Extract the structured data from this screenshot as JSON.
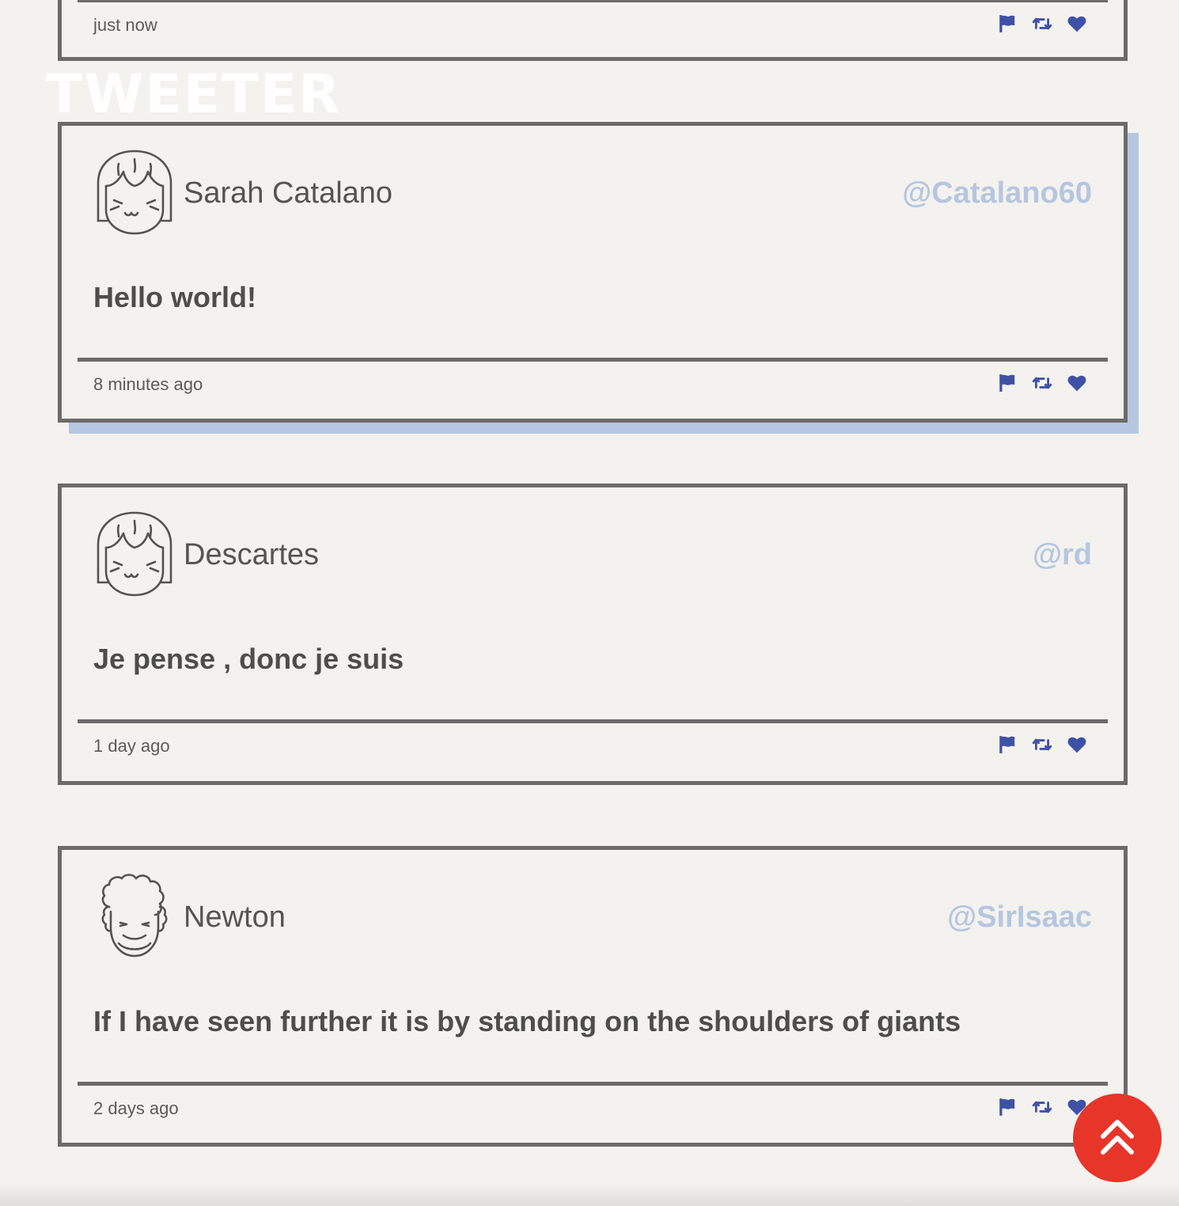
{
  "logo": {
    "text": "TWEETER"
  },
  "colors": {
    "background": "#f3f2ee",
    "border": "#6b6b69",
    "handle": "#b6c6e0",
    "shadow": "#b6c6e0",
    "icon": "#3f51a6",
    "scroll_button": "#e8352a"
  },
  "icons": {
    "flag": "flag-icon",
    "retweet": "retweet-icon",
    "like": "heart-icon",
    "scroll": "chevrons-up-icon"
  },
  "tweets": [
    {
      "time": "just now"
    },
    {
      "name": "Sarah Catalano",
      "handle": "@Catalano60",
      "text": "Hello world!",
      "time": "8 minutes ago"
    },
    {
      "name": "Descartes",
      "handle": "@rd",
      "text": "Je pense , donc je suis",
      "time": "1 day ago"
    },
    {
      "name": "Newton",
      "handle": "@SirIsaac",
      "text": "If I have seen further it is by standing on the shoulders of giants",
      "time": "2 days ago"
    }
  ]
}
